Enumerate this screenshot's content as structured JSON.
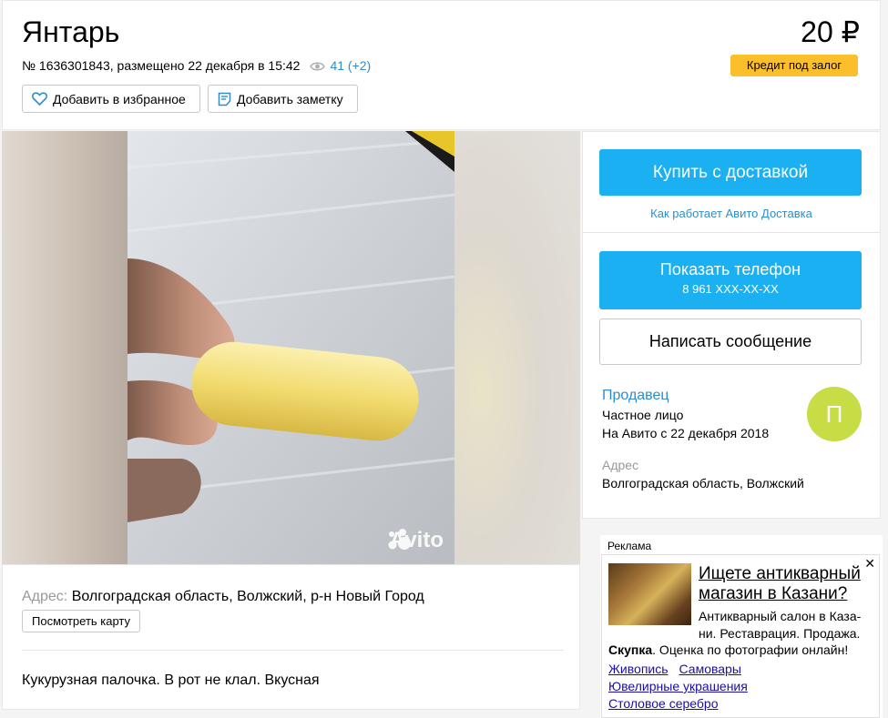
{
  "header": {
    "title": "Янтарь",
    "meta": "№ 1636301843, размещено 22 декабря в 15:42",
    "views": "41 (+2)",
    "price": "20 ₽",
    "credit_label": "Кредит под залог",
    "favorite_label": "Добавить в избранное",
    "note_label": "Добавить заметку"
  },
  "gallery": {
    "watermark": "Avito"
  },
  "address_panel": {
    "label": "Адрес:",
    "value": "Волгоградская область, Волжский, р-н Новый Город",
    "map_button": "Посмотреть карту",
    "description": "Кукурузная палочка. В рот не клал. Вкусная"
  },
  "sidebar": {
    "buy_label": "Купить с доставкой",
    "how_link": "Как работает Авито Доставка",
    "phone_label": "Показать телефон",
    "phone_number": "8 961 XXX-XX-XX",
    "message_label": "Написать сообщение",
    "seller_link": "Продавец",
    "seller_type": "Частное лицо",
    "seller_since": "На Авито с 22 декабря 2018",
    "avatar_letter": "П",
    "address_label": "Адрес",
    "address_value": "Волгоградская область, Волжский"
  },
  "ad": {
    "label": "Реклама",
    "title": "Ищете антикварный магазин в Казани?",
    "text": "Антикварный салон в Каза-ни. Реставрация. Продажа.",
    "bold": "Скупка",
    "text2": ". Оценка по фотографии онлайн!",
    "links": [
      "Живопись",
      "Самовары",
      "Ювелирные украшения",
      "Столовое серебро"
    ]
  },
  "colors": {
    "accent_blue": "#1bb0f2",
    "link_blue": "#2f8dc9",
    "credit_yellow": "#fcbf2c",
    "avatar_green": "#c7dc45"
  }
}
